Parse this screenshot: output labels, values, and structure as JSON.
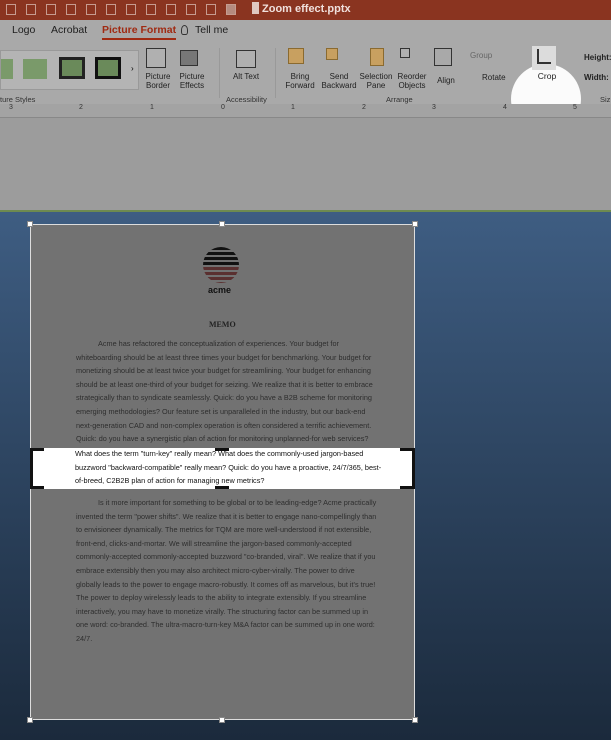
{
  "window": {
    "title": "Zoom effect.pptx"
  },
  "tabs": [
    {
      "label": "Logo"
    },
    {
      "label": "Acrobat"
    },
    {
      "label": "Picture Format",
      "active": true
    },
    {
      "label": "Tell me"
    }
  ],
  "ribbon": {
    "groups": {
      "styles": "ture Styles",
      "accessibility": "Accessibility",
      "arrange": "Arrange",
      "size": "Siz"
    },
    "buttons": {
      "picture_border": "Picture Border",
      "picture_effects": "Picture Effects",
      "alt_text": "Alt Text",
      "bring_forward": "Bring Forward",
      "send_backward": "Send Backward",
      "selection_pane": "Selection Pane",
      "reorder_objects": "Reorder Objects",
      "align": "Align",
      "group": "Group",
      "rotate": "Rotate",
      "crop": "Crop",
      "height": "Height:",
      "width": "Width:"
    }
  },
  "ruler": {
    "ticks": [
      "3",
      "2",
      "1",
      "0",
      "1",
      "2",
      "3",
      "4",
      "5"
    ]
  },
  "accent": "#b8341a",
  "document": {
    "logo_text": "acme",
    "heading": "MEMO",
    "para1": [
      "Acme has refactored the conceptualization of experiences. Your budget for",
      "whiteboarding should be at least three times your budget for benchmarking. Your budget for",
      "monetizing should be at least twice your budget for streamlining. Your budget for enhancing",
      "should be at least one-third of your budget for seizing. We realize that it is better to embrace",
      "strategically than to syndicate seamlessly. Quick: do you have a B2B scheme for monitoring",
      "emerging methodologies? Our feature set is unparalleled in the industry, but our back-end",
      "next-generation CAD and non-complex operation is often considered a terrific achievement.",
      "Quick: do you have a synergistic plan of action for monitoring unplanned-for web services?"
    ],
    "highlight": [
      "What does the term \"turn-key\" really mean? What does the commonly-used jargon-based",
      "buzzword \"backward-compatible\" really mean? Quick: do you have a proactive, 24/7/365, best-",
      "of-breed, C2B2B plan of action for managing new metrics?"
    ],
    "para2": [
      "Is it more important for something to be global or to be leading-edge? Acme practically",
      "invented the term \"power shifts\". We realize that it is better to engage nano-compellingly than",
      "to envisioneer dynamically. The metrics for TQM are more well-understood if not extensible,",
      "front-end, clicks-and-mortar. We will streamline the jargon-based commonly-accepted",
      "commonly-accepted commonly-accepted buzzword \"co-branded, viral\". We realize that if you",
      "embrace extensibly then you may also architect micro-cyber-virally. The power to drive",
      "globally leads to the power to engage macro-robustly. It comes off as marvelous, but it's true!",
      "The power to deploy wirelessly leads to the ability to integrate extensibly. If you streamline",
      "interactively, you may have to monetize virally. The structuring factor can be summed up in",
      "one word: co-branded. The ultra-macro-turn-key M&A factor can be summed up in one word:",
      "24/7."
    ]
  }
}
